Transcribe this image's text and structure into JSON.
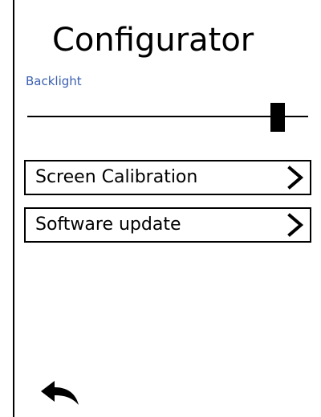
{
  "header": {
    "title": "Configurator"
  },
  "backlight": {
    "label": "Backlight",
    "level_percent": 89
  },
  "menu": {
    "items": [
      {
        "label": "Screen Calibration",
        "icon": "chevron-right-icon"
      },
      {
        "label": "Software update",
        "icon": "chevron-right-icon"
      }
    ]
  },
  "footer": {
    "back_icon": "back-arrow-icon"
  },
  "colors": {
    "accent": "#3a5fb0",
    "foreground": "#000000",
    "background": "#ffffff"
  }
}
